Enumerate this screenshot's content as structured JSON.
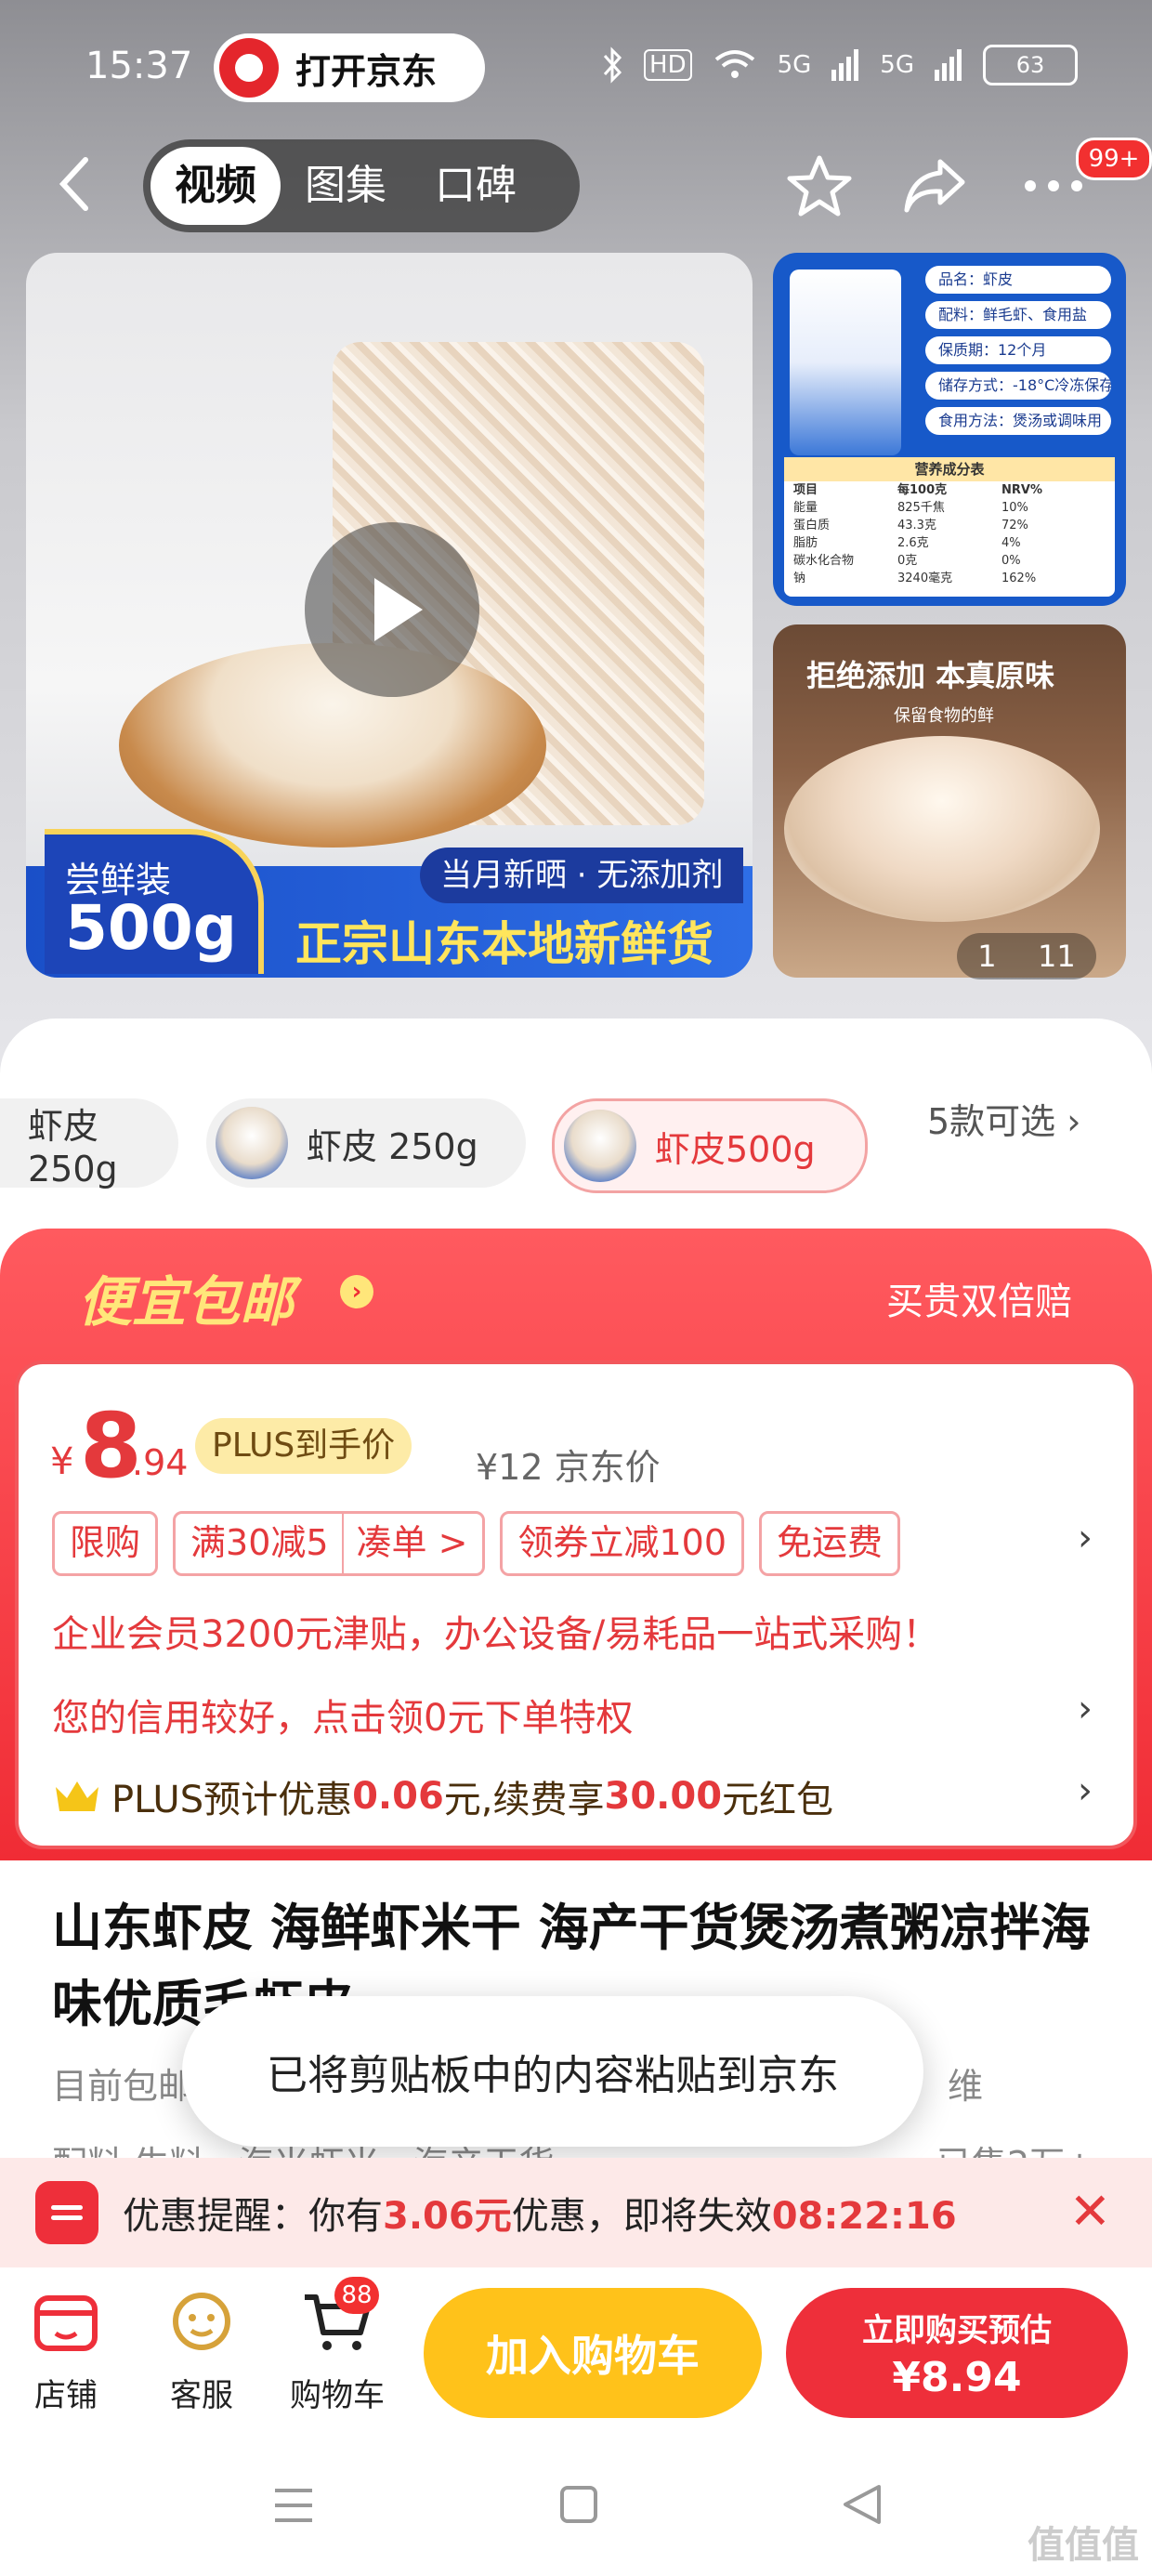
{
  "status_bar": {
    "time": "15:37",
    "open_app": "打开京东",
    "hd": "HD",
    "signal1": "5G",
    "signal2": "5G",
    "battery": "63"
  },
  "nav": {
    "tabs": [
      "视频",
      "图集",
      "口碑"
    ],
    "active_tab": 0,
    "badge": "99+"
  },
  "gallery": {
    "fresh_label": "尝鲜装",
    "fresh_weight": "500g",
    "new_label": "当月新晒 · 无添加剂",
    "banner_text": "正宗山东本地新鲜货",
    "info_rows": [
      "品名：虾皮",
      "配料：鲜毛虾、食用盐",
      "保质期：12个月",
      "储存方式：-18°C冷冻保存",
      "食用方法：煲汤或调味用"
    ],
    "nutrition_title": "营养成分表",
    "nutrition_header": [
      "项目",
      "每100克",
      "NRV%"
    ],
    "nutrition_rows": [
      [
        "能量",
        "825千焦",
        "10%"
      ],
      [
        "蛋白质",
        "43.3克",
        "72%"
      ],
      [
        "脂肪",
        "2.6克",
        "4%"
      ],
      [
        "碳水化合物",
        "0克",
        "0%"
      ],
      [
        "钠",
        "3240毫克",
        "162%"
      ]
    ],
    "side2_title": "拒绝添加 本真原味",
    "side2_sub": "保留食物的鲜",
    "counter_current": "1",
    "counter_total": "11"
  },
  "variants": {
    "items": [
      "虾皮250g",
      "虾皮 250g",
      "虾皮500g"
    ],
    "selected": 2,
    "more": "5款可选"
  },
  "promo": {
    "cheap_label": "便宜包邮",
    "double_label": "买贵双倍赔",
    "price_symbol": "¥",
    "price_int": "8",
    "price_dec": ".94",
    "plus_price_label": "PLUS到手价",
    "orig_price": "¥12  京东价",
    "chips": [
      "限购",
      "满30减5",
      "凑单 >",
      "领券立减100",
      "免运费"
    ],
    "enterprise_line": "企业会员3200元津贴，办公设备/易耗品一站式采购！",
    "credit_line": "您的信用较好，点击领0元下单特权",
    "plus_prefix": "PLUS预计优惠",
    "plus_save": "0.06",
    "plus_mid": "元,续费享",
    "plus_bonus": "30.00",
    "plus_suffix": "元红包"
  },
  "product": {
    "title": "山东虾皮 海鲜虾米干 海产干货煲汤煮粥凉拌海味优质毛虾皮",
    "sub1_left": "目前包邮",
    "sub1_right": "维",
    "sub2_left": "配料 生料 · 海米虾米 · 海产干货",
    "sub2_right": "已售2万+"
  },
  "toast": "已将剪贴板中的内容粘贴到京东",
  "reminder": {
    "prefix": "优惠提醒：你有",
    "amount": "3.06元",
    "mid": "优惠，即将失效",
    "countdown": "08:22:16"
  },
  "bottom_bar": {
    "shop": "店铺",
    "service": "客服",
    "cart": "购物车",
    "cart_count": "88",
    "add_cart": "加入购物车",
    "buy_label": "立即购买预估",
    "buy_price": "¥8.94"
  },
  "watermark": "值值值",
  "colors": {
    "brand_red": "#e4393c",
    "add_cart_yellow": "#ffc21a",
    "promo_gold": "#ffe67a"
  }
}
